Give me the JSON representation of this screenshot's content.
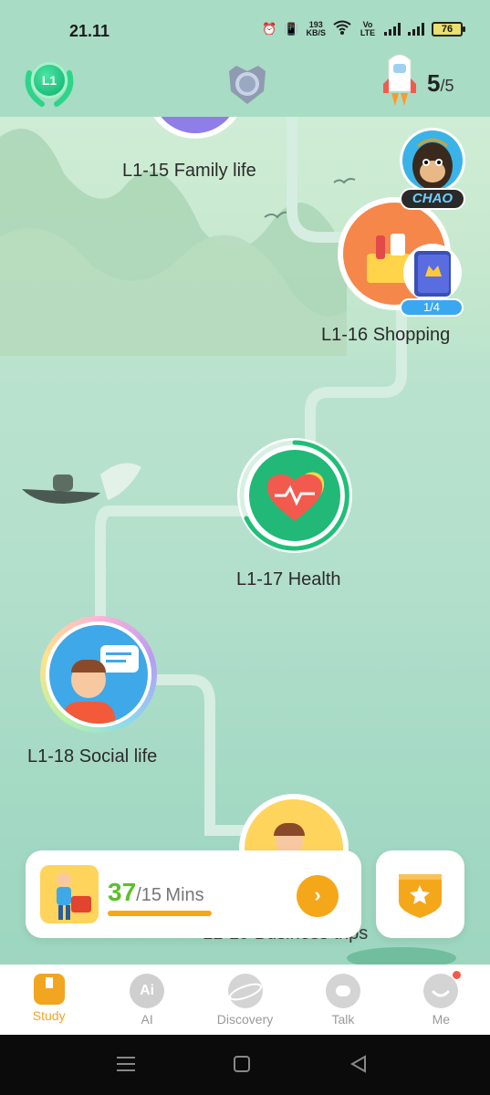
{
  "status_bar": {
    "time": "21.11",
    "net_speed_value": "193",
    "net_speed_unit": "KB/S",
    "volte": "Vo LTE",
    "battery": "76"
  },
  "header": {
    "level_badge": "L1",
    "stars_current": "5",
    "stars_total": "/5"
  },
  "path": {
    "nodes": [
      {
        "label": "L1-15 Family life"
      },
      {
        "label": "L1-16 Shopping",
        "progress": "1/4"
      },
      {
        "label": "L1-17 Health"
      },
      {
        "label": "L1-18 Social life"
      },
      {
        "label": "L1-19 Business trips"
      }
    ],
    "mascot_tag": "CHAO"
  },
  "study_card": {
    "minutes_done": "37",
    "minutes_goal": "/15",
    "unit": "Mins",
    "go_icon": "chevron-right-icon"
  },
  "tabs": [
    {
      "label": "Study",
      "icon": "book-icon",
      "active": true
    },
    {
      "label": "AI",
      "icon_text": "Ai",
      "icon": "ai-icon"
    },
    {
      "label": "Discovery",
      "icon": "planet-icon"
    },
    {
      "label": "Talk",
      "icon": "chat-icon"
    },
    {
      "label": "Me",
      "icon": "smile-icon",
      "badge": true
    }
  ],
  "colors": {
    "accent": "#f5a71a",
    "active_tab": "#f2a520",
    "progress_green": "#5cbf2a",
    "node_green": "#1fbf77"
  }
}
